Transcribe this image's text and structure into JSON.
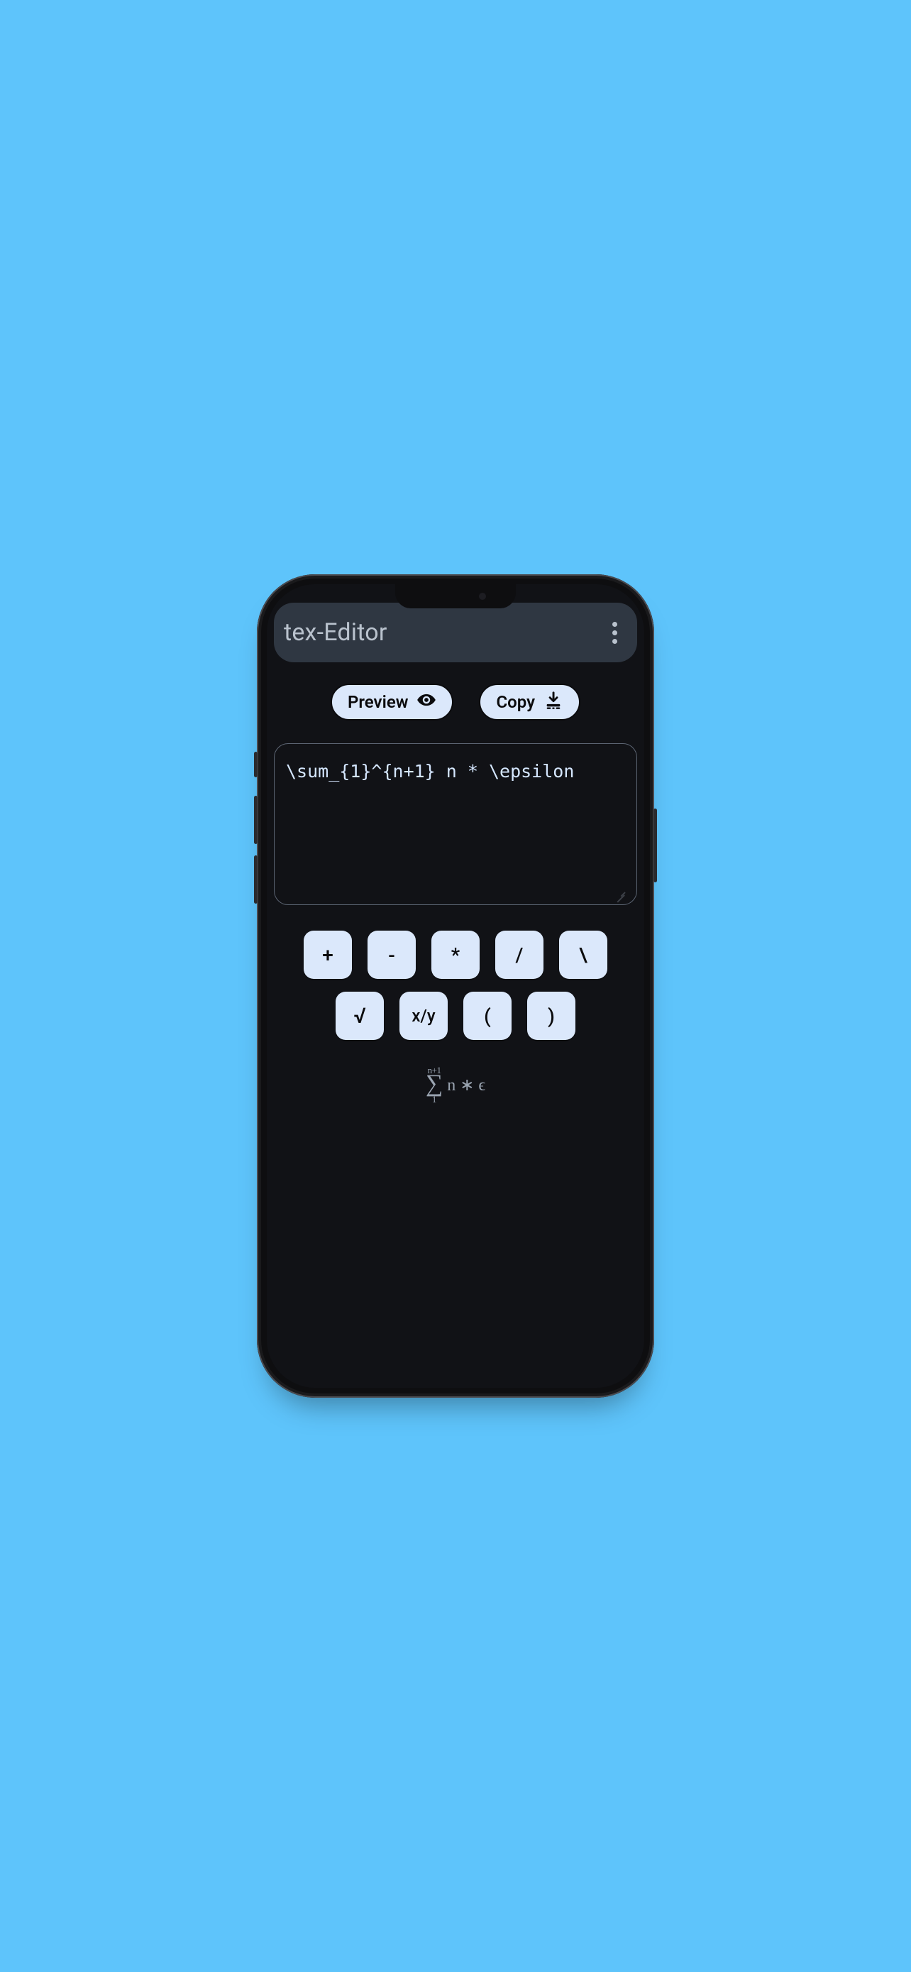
{
  "appbar": {
    "title": "tex-Editor"
  },
  "toolbar": {
    "preview_label": "Preview",
    "copy_label": "Copy"
  },
  "editor": {
    "value": "\\sum_{1}^{n+1} n * \\epsilon"
  },
  "keys": {
    "row1": [
      "+",
      "-",
      "*",
      "/",
      "\\"
    ],
    "row2": [
      "√",
      "x/y",
      "(",
      ")"
    ]
  },
  "render": {
    "upper": "n+1",
    "sigma": "∑",
    "lower": "1",
    "body": "n ∗ ϵ"
  }
}
